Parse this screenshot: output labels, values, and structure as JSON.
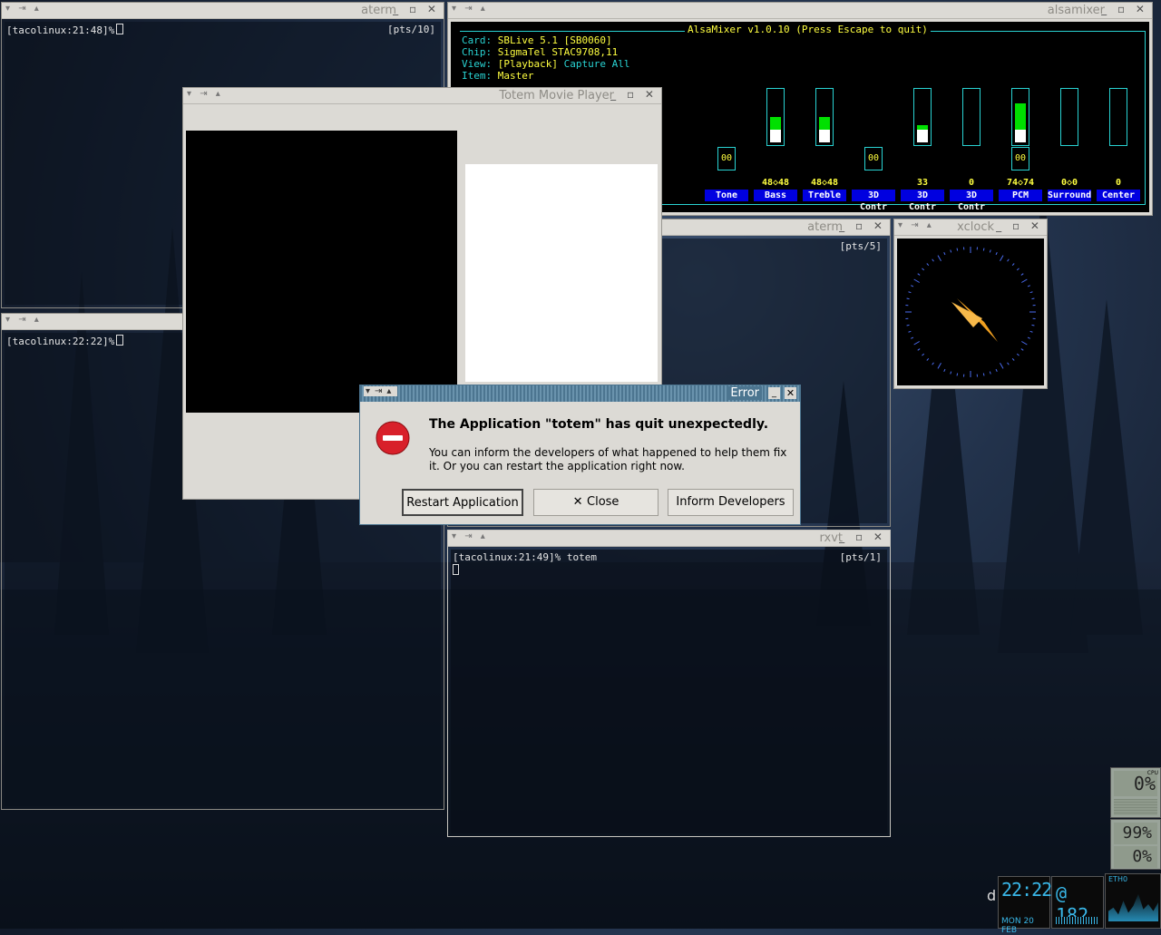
{
  "windows": {
    "aterm1": {
      "title": "aterm",
      "prompt": "[tacolinux:21:48]%",
      "pts": "[pts/10]"
    },
    "aterm2": {
      "prompt": "[tacolinux:22:22]%"
    },
    "aterm3": {
      "title": "aterm",
      "pts": "[pts/5]"
    },
    "rxvt": {
      "title": "rxvt",
      "prompt": "[tacolinux:21:49]% totem",
      "pts": "[pts/1]"
    },
    "totem": {
      "title": "Totem Movie Player"
    },
    "xclock": {
      "title": "xclock"
    },
    "alsamixer": {
      "title": "alsamixer",
      "header": "AlsaMixer v1.0.10 (Press Escape to quit)",
      "card_label": "Card:",
      "card": "SBLive 5.1 [SB0060]",
      "chip_label": "Chip:",
      "chip": "SigmaTel STAC9708,11",
      "view_label": "View:",
      "view_playback": "[Playback]",
      "view_capture": "Capture",
      "view_all": "All",
      "item_label": "Item:",
      "item": "Master",
      "channels": [
        {
          "label": "Tone",
          "value": "",
          "level": null,
          "switch": "00"
        },
        {
          "label": "Bass",
          "value": "48<>48",
          "level": 0.48,
          "switch": ""
        },
        {
          "label": "Treble",
          "value": "48<>48",
          "level": 0.48,
          "switch": ""
        },
        {
          "label": "3D Contr",
          "value": "",
          "level": null,
          "switch": "00"
        },
        {
          "label": "3D Contr",
          "value": "33",
          "level": 0.33,
          "switch": ""
        },
        {
          "label": "3D Contr",
          "value": "0",
          "level": 0,
          "switch": ""
        },
        {
          "label": "PCM",
          "value": "74<>74",
          "level": 0.74,
          "switch": "00"
        },
        {
          "label": "Surround",
          "value": "0<>0",
          "level": 0,
          "switch": ""
        },
        {
          "label": "Center",
          "value": "0",
          "level": 0,
          "switch": ""
        }
      ]
    }
  },
  "dialog": {
    "title": "Error",
    "heading": "The Application \"totem\" has quit unexpectedly.",
    "body": "You can inform the developers of what happened to help them fix it.  Or you can restart the application right now.",
    "restart": "Restart Application",
    "close": "Close",
    "inform": "Inform Developers"
  },
  "dock": {
    "cpu1": "0%",
    "cpu1_label": "CPU",
    "mem": "99%",
    "cpu2": "0%",
    "time": "22:22",
    "date": "MON 20 FEB",
    "beat": "@ 182",
    "net_label": "ETH0",
    "desk_letter": "d"
  },
  "colors": {
    "accent": "#4c7590",
    "alsa_bg": "#000000",
    "alsa_text": "#ffff40",
    "alsa_border": "#29d3d3",
    "error_red": "#d8202a"
  }
}
